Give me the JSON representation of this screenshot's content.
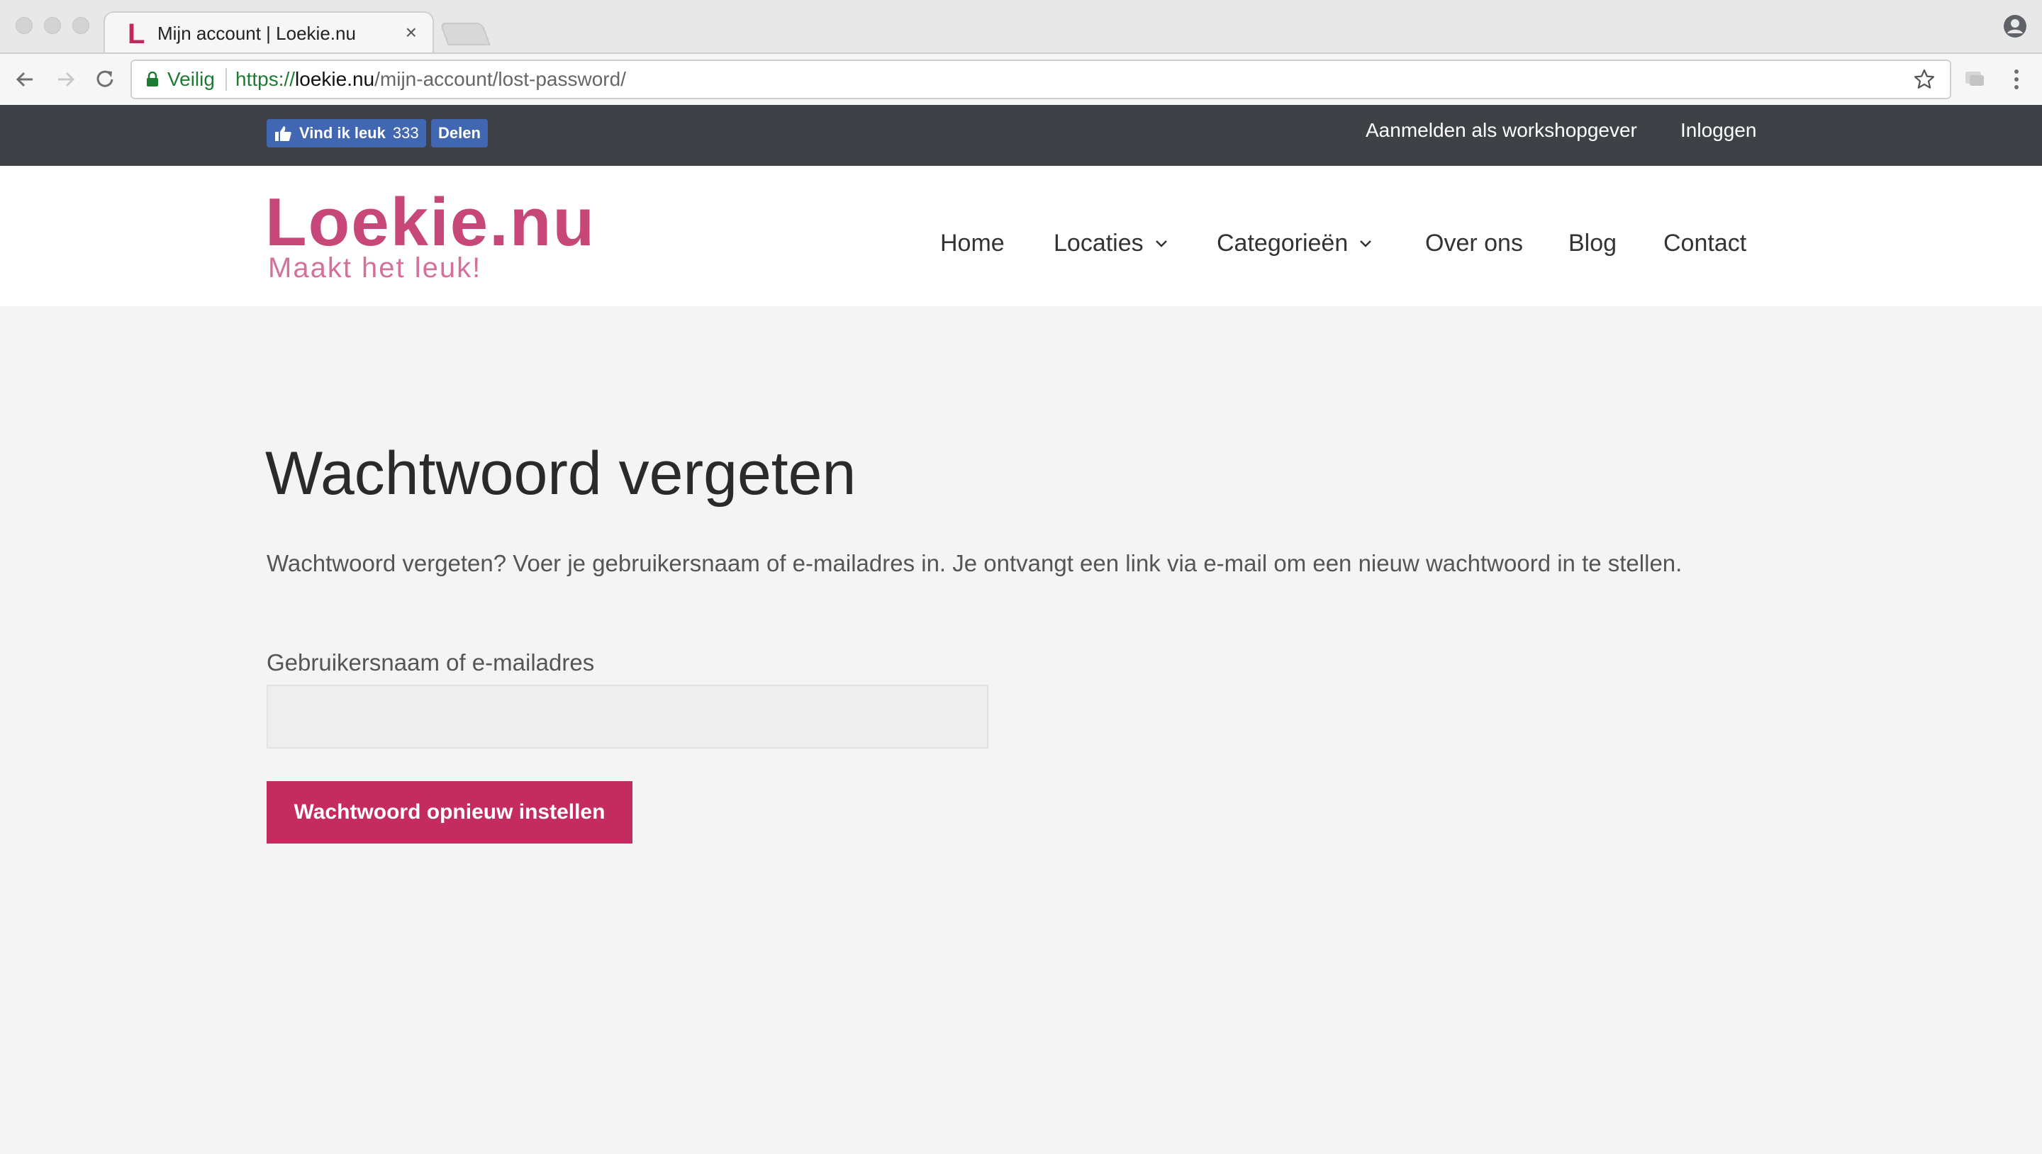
{
  "browser": {
    "tab_title": "Mijn account | Loekie.nu",
    "tab_favicon": "L",
    "tab_close": "×",
    "secure_label": "Veilig",
    "url_scheme": "https://",
    "url_host": "loekie.nu",
    "url_path": "/mijn-account/lost-password/"
  },
  "topbar": {
    "fb_like_label": "Vind ik leuk",
    "fb_like_count": "333",
    "fb_share_label": "Delen",
    "links": [
      "Aanmelden als workshopgever",
      "Inloggen"
    ]
  },
  "header": {
    "logo_main": "Loekie.nu",
    "logo_tagline": "Maakt het leuk!",
    "nav": [
      {
        "label": "Home",
        "has_dropdown": false
      },
      {
        "label": "Locaties",
        "has_dropdown": true
      },
      {
        "label": "Categorieën",
        "has_dropdown": true
      },
      {
        "label": "Over ons",
        "has_dropdown": false
      },
      {
        "label": "Blog",
        "has_dropdown": false
      },
      {
        "label": "Contact",
        "has_dropdown": false
      }
    ]
  },
  "content": {
    "title": "Wachtwoord vergeten",
    "intro": "Wachtwoord vergeten? Voer je gebruikersnaam of e-mailadres in. Je ontvangt een link via e-mail om een nieuw wachtwoord in te stellen.",
    "field_label": "Gebruikersnaam of e-mailadres",
    "field_value": "",
    "submit_label": "Wachtwoord opnieuw instellen"
  },
  "colors": {
    "brand_pink": "#c42b5f",
    "logo_pink": "#c74778",
    "topbar_bg": "#3e4146",
    "facebook_blue": "#4267b2",
    "secure_green": "#1e7b34"
  },
  "icons": [
    "back-arrow-icon",
    "forward-arrow-icon",
    "reload-icon",
    "lock-icon",
    "star-icon",
    "extension-icon",
    "menu-dots-icon",
    "profile-icon",
    "thumbs-up-icon",
    "chevron-down-icon"
  ]
}
